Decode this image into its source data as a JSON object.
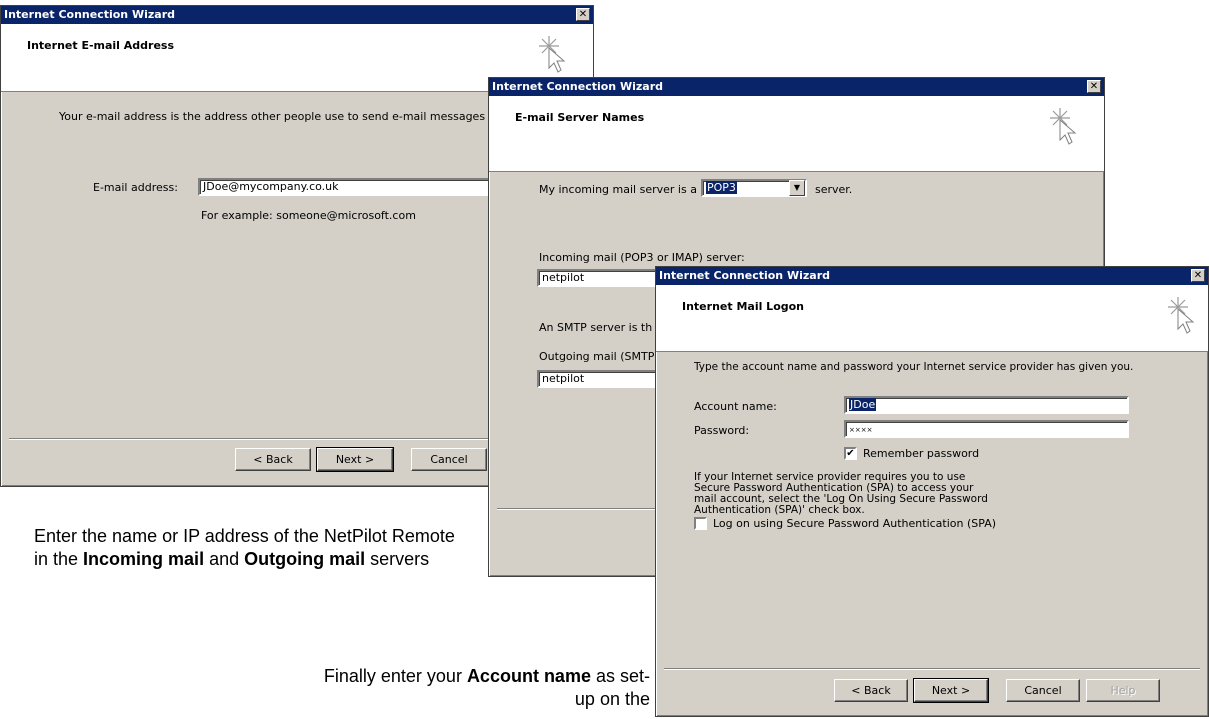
{
  "win1": {
    "title": "Internet Connection Wizard",
    "header": "Internet E-mail Address",
    "intro": "Your e-mail address is the address other people use to send e-mail messages to you",
    "email_label": "E-mail address:",
    "email_value": "JDoe@mycompany.co.uk",
    "example": "For example: someone@microsoft.com",
    "back": "< Back",
    "next": "Next >",
    "cancel": "Cancel"
  },
  "win2": {
    "title": "Internet Connection Wizard",
    "header": "E-mail Server Names",
    "server_prefix": "My incoming mail server is a",
    "server_type": "POP3",
    "server_suffix": "server.",
    "incoming_label": "Incoming mail (POP3 or IMAP) server:",
    "incoming_value": "netpilot",
    "smtp_text": "An SMTP server is th",
    "outgoing_label": "Outgoing mail (SMTP",
    "outgoing_value": "netpilot"
  },
  "win3": {
    "title": "Internet Connection Wizard",
    "header": "Internet Mail Logon",
    "intro": "Type the account name and password your Internet service provider has given you.",
    "account_label": "Account name:",
    "account_value": "JDoe",
    "password_label": "Password:",
    "password_value": "××××",
    "remember_label": "Remember password",
    "remember_checked": true,
    "spa_text": "If your Internet service provider requires you to use Secure Password Authentication (SPA) to access your mail account, select the 'Log On Using Secure Password Authentication (SPA)' check box.",
    "spa_label": "Log on using Secure Password Authentication (SPA)",
    "spa_checked": false,
    "back": "< Back",
    "next": "Next >",
    "cancel": "Cancel",
    "help": "Help"
  },
  "doc": {
    "para1_a": "Enter the name or IP address of the NetPilot Remote in the ",
    "para1_b": "Incoming mail",
    "para1_c": " and ",
    "para1_d": "Outgoing mail",
    "para1_e": " servers",
    "para2_a": "Finally enter your ",
    "para2_b": "Account name",
    "para2_c": " as set-up on the"
  },
  "close_glyph": "✕",
  "dropdown_glyph": "▼",
  "check_glyph": "✔"
}
